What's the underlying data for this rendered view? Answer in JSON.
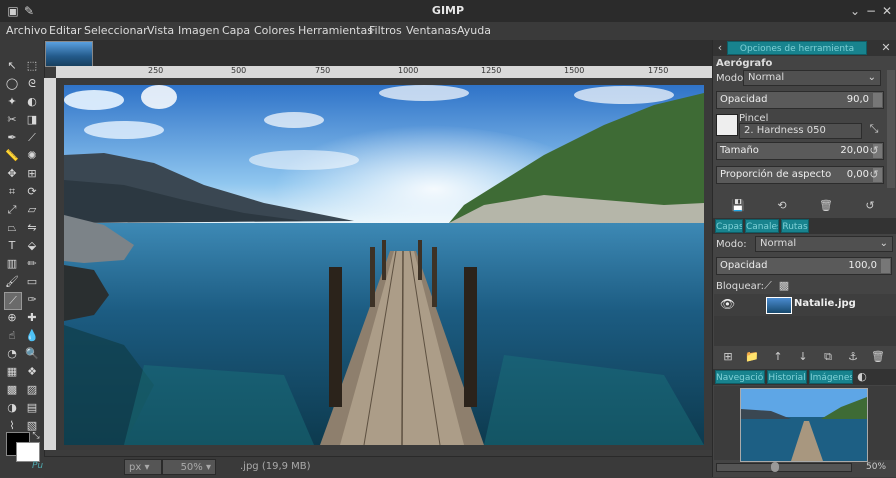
{
  "window": {
    "title": "GIMP"
  },
  "menu": [
    "Archivo",
    "Editar",
    "Seleccionar",
    "Vista",
    "Imagen",
    "Capa",
    "Colores",
    "Herramientas",
    "Filtros",
    "Ventanas",
    "Ayuda"
  ],
  "rulers": {
    "marks": [
      "250",
      "500",
      "750",
      "1000",
      "1250",
      "1500",
      "1750"
    ]
  },
  "status": {
    "unit": "px",
    "zoom": "50%",
    "file_info": ".jpg (19,9 MB)"
  },
  "tool_options": {
    "tab_label": "Opciones de herramienta",
    "tool_name": "Aerógrafo",
    "mode_label": "Modo:",
    "mode_value": "Normal",
    "opacity_label": "Opacidad",
    "opacity_value": "90,0",
    "brush_label": "Pincel",
    "brush_value": "2. Hardness 050",
    "size_label": "Tamaño",
    "size_value": "20,00",
    "aspect_label": "Proporción de aspecto",
    "aspect_value": "0,00"
  },
  "layers": {
    "tabs": [
      "Capas",
      "Canales",
      "Rutas"
    ],
    "mode_label": "Modo:",
    "mode_value": "Normal",
    "opacity_label": "Opacidad",
    "opacity_value": "100,0",
    "lock_label": "Bloquear:",
    "layer_name": "Natalie.jpg"
  },
  "navigator": {
    "tabs": [
      "Navegación",
      "Historial",
      "Imágenes"
    ],
    "zoom": "50%"
  },
  "colors": {
    "accent": "#18838e",
    "panel": "#444444",
    "canvas_bg": "#3a3a3a"
  }
}
